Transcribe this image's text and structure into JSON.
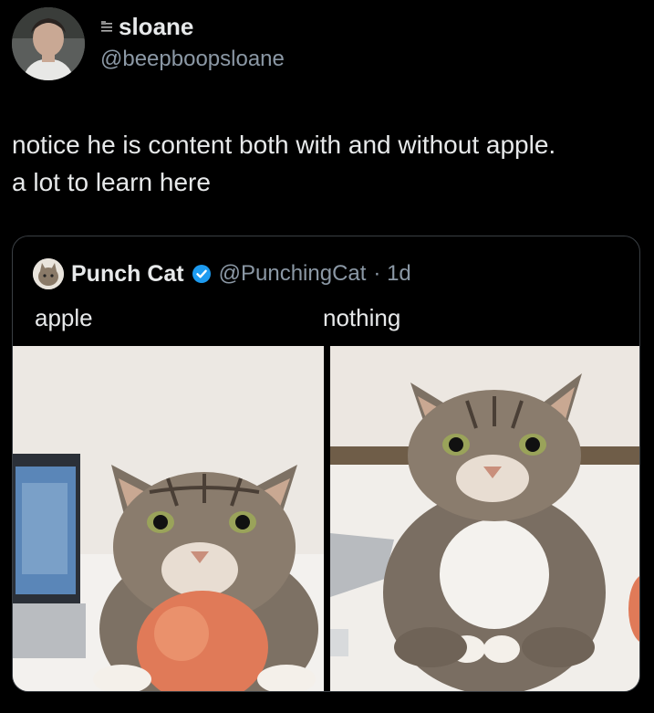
{
  "author": {
    "name": "sloane",
    "handle": "@beepboopsloane"
  },
  "tweet": {
    "text_line1": "notice he is content both with and without apple.",
    "text_line2": "a lot to learn here"
  },
  "quoted_tweet": {
    "name": "Punch Cat",
    "handle": "@PunchingCat",
    "time": "· 1d",
    "verified": true,
    "caption_left": "apple",
    "caption_right": "nothing",
    "images": [
      {
        "description": "tabby cat resting chin on an apple"
      },
      {
        "description": "tabby cat sitting without apple"
      }
    ]
  },
  "colors": {
    "background": "#000000",
    "text_primary": "#e7e9ea",
    "text_secondary": "#8b98a5",
    "verified": "#1d9bf0",
    "border": "#3a3f44"
  },
  "icons": [
    "flag-icon",
    "verified-badge-icon"
  ]
}
